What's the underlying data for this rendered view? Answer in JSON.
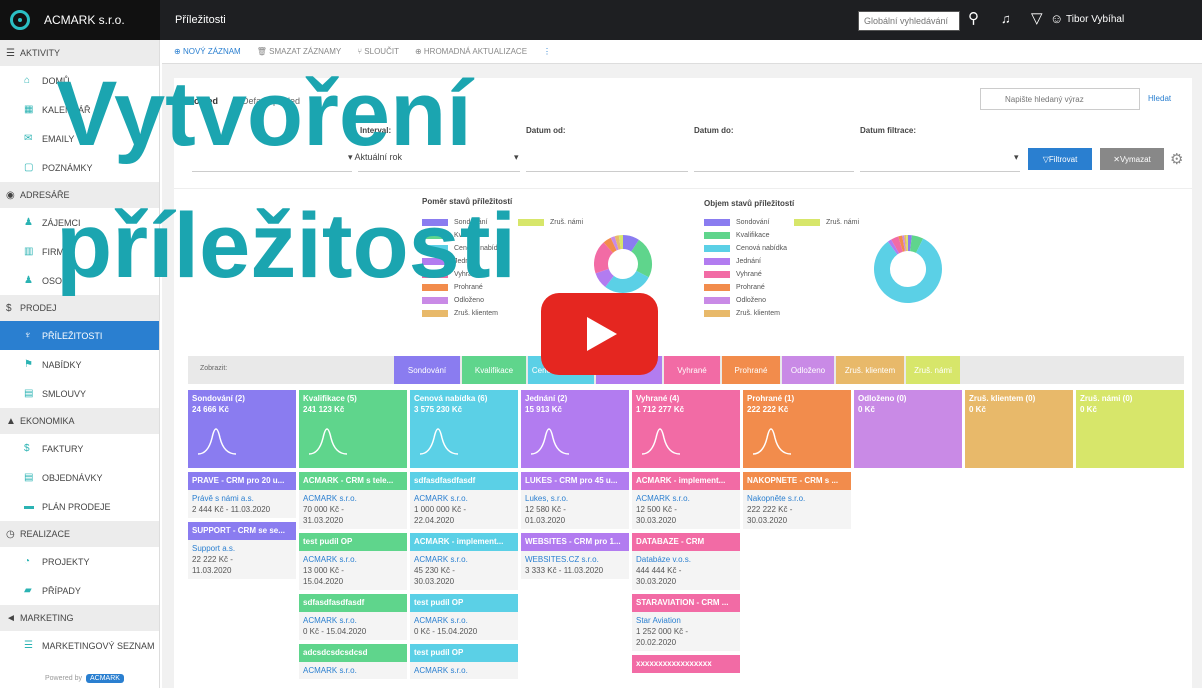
{
  "app": {
    "brand": "ACMARK s.r.o.",
    "page_title": "Příležitosti",
    "global_search_placeholder": "Globální vyhledávání",
    "user": "Tibor Vybíhal"
  },
  "sidebar": {
    "items": [
      {
        "type": "section",
        "label": "AKTIVITY",
        "icon": "list-icon"
      },
      {
        "type": "item",
        "label": "DOMŮ",
        "icon": "home-icon"
      },
      {
        "type": "item",
        "label": "KALENDÁŘ",
        "icon": "calendar-icon"
      },
      {
        "type": "item",
        "label": "EMAILY",
        "icon": "mail-icon"
      },
      {
        "type": "item",
        "label": "POZNÁMKY",
        "icon": "note-icon"
      },
      {
        "type": "section",
        "label": "ADRESÁŘE",
        "icon": "address-icon"
      },
      {
        "type": "item",
        "label": "ZÁJEMCI",
        "icon": "person-icon"
      },
      {
        "type": "item",
        "label": "FIRMY",
        "icon": "building-icon"
      },
      {
        "type": "item",
        "label": "OSOBY",
        "icon": "people-icon"
      },
      {
        "type": "section",
        "label": "PRODEJ",
        "icon": "dollar-icon"
      },
      {
        "type": "item",
        "label": "PŘÍLEŽITOSTI",
        "icon": "rocket-icon",
        "active": true
      },
      {
        "type": "item",
        "label": "NABÍDKY",
        "icon": "flag-icon"
      },
      {
        "type": "item",
        "label": "SMLOUVY",
        "icon": "doc-icon"
      },
      {
        "type": "section",
        "label": "EKONOMIKA",
        "icon": "chart-icon"
      },
      {
        "type": "item",
        "label": "FAKTURY",
        "icon": "dollar-icon"
      },
      {
        "type": "item",
        "label": "OBJEDNÁVKY",
        "icon": "order-icon"
      },
      {
        "type": "item",
        "label": "PLÁN PRODEJE",
        "icon": "plan-icon"
      },
      {
        "type": "section",
        "label": "REALIZACE",
        "icon": "realize-icon"
      },
      {
        "type": "item",
        "label": "PROJEKTY",
        "icon": "project-icon"
      },
      {
        "type": "item",
        "label": "PŘÍPADY",
        "icon": "folder-icon"
      },
      {
        "type": "section",
        "label": "MARKETING",
        "icon": "megaphone-icon"
      },
      {
        "type": "item",
        "label": "MARKETINGOVÝ SEZNAM",
        "icon": "list-icon"
      }
    ],
    "powered_by": "Powered by",
    "powered_brand": "ACMARK"
  },
  "toolbar": {
    "new": "NOVÝ ZÁZNAM",
    "delete": "SMAZAT ZÁZNAMY",
    "merge": "SLOUČIT",
    "mass_update": "HROMADNÁ AKTUALIZACE"
  },
  "tabs": {
    "view": "Pohled",
    "default": "Default pohled"
  },
  "search": {
    "placeholder": "Napište hledaný výraz",
    "link": "Hledat"
  },
  "filters": {
    "interval_label": "Interval:",
    "interval_value": "Aktuální rok",
    "date_from_label": "Datum od:",
    "date_to_label": "Datum do:",
    "filter_date_label": "Datum filtrace:",
    "filter_btn": "Filtrovat",
    "clear_btn": "Vymazat"
  },
  "charts": {
    "ratio_title": "Poměr stavů příležitostí",
    "volume_title": "Objem stavů příležitostí",
    "legend": [
      "Sondování",
      "Kvalifikace",
      "Cenová nabídka",
      "Jednání",
      "Vyhrané",
      "Prohrané",
      "Odloženo",
      "Zruš. klientem",
      "Zruš. námi"
    ],
    "colors": [
      "#8a7cf0",
      "#5fd58c",
      "#5bd0e6",
      "#b27cf0",
      "#f26ba5",
      "#f28c4c",
      "#c98ae6",
      "#e8b96a",
      "#d7e66a"
    ]
  },
  "show_label": "Zobrazit:",
  "chips": [
    "Sondování",
    "Kvalifikace",
    "Cenová nabídka",
    "Jednání",
    "Vyhrané",
    "Prohrané",
    "Odloženo",
    "Zruš. klientem",
    "Zruš. námi"
  ],
  "columns": [
    {
      "title": "Sondování (2)",
      "amount": "24 666 Kč",
      "color": "#8a7cf0",
      "cards": [
        {
          "title": "PRAVE - CRM pro 20 u...",
          "company": "Právě s námi a.s.",
          "info1": "2 444 Kč - 11.03.2020",
          "info2": ""
        },
        {
          "title": "SUPPORT - CRM se se...",
          "company": "Support a.s.",
          "info1": "22 222 Kč -",
          "info2": "11.03.2020"
        }
      ]
    },
    {
      "title": "Kvalifikace (5)",
      "amount": "241 123 Kč",
      "color": "#5fd58c",
      "cards": [
        {
          "title": "ACMARK - CRM s tele...",
          "company": "ACMARK s.r.o.",
          "info1": "70 000 Kč -",
          "info2": "31.03.2020"
        },
        {
          "title": "test pudíl OP",
          "company": "ACMARK s.r.o.",
          "info1": "13 000 Kč -",
          "info2": "15.04.2020"
        },
        {
          "title": "sdfasdfasdfasdf",
          "company": "ACMARK s.r.o.",
          "info1": "0 Kč - 15.04.2020",
          "info2": ""
        },
        {
          "title": "adcsdcsdcsdcsd",
          "company": "ACMARK s.r.o.",
          "info1": "",
          "info2": ""
        }
      ]
    },
    {
      "title": "Cenová nabídka (6)",
      "amount": "3 575 230 Kč",
      "color": "#5bd0e6",
      "cards": [
        {
          "title": "sdfasdfasdfasdf",
          "company": "ACMARK s.r.o.",
          "info1": "1 000 000 Kč -",
          "info2": "22.04.2020"
        },
        {
          "title": "ACMARK - implement...",
          "company": "ACMARK s.r.o.",
          "info1": "45 230 Kč -",
          "info2": "30.03.2020"
        },
        {
          "title": "test pudíl OP",
          "company": "ACMARK s.r.o.",
          "info1": "0 Kč - 15.04.2020",
          "info2": ""
        },
        {
          "title": "test pudíl OP",
          "company": "ACMARK s.r.o.",
          "info1": "",
          "info2": ""
        }
      ]
    },
    {
      "title": "Jednání (2)",
      "amount": "15 913 Kč",
      "color": "#b27cf0",
      "cards": [
        {
          "title": "LUKES - CRM pro 45 u...",
          "company": "Lukes, s.r.o.",
          "info1": "12 580 Kč -",
          "info2": "01.03.2020"
        },
        {
          "title": "WEBSITES - CRM pro 1...",
          "company": "WEBSITES.CZ s.r.o.",
          "info1": "3 333 Kč - 11.03.2020",
          "info2": ""
        }
      ]
    },
    {
      "title": "Vyhrané (4)",
      "amount": "1 712 277 Kč",
      "color": "#f26ba5",
      "cards": [
        {
          "title": "ACMARK - implement...",
          "company": "ACMARK s.r.o.",
          "info1": "12 500 Kč -",
          "info2": "30.03.2020"
        },
        {
          "title": "DATABAZE - CRM",
          "company": "Databáze v.o.s.",
          "info1": "444 444 Kč -",
          "info2": "30.03.2020"
        },
        {
          "title": "STARAVIATION - CRM ...",
          "company": "Star Aviation",
          "info1": "1 252 000 Kč -",
          "info2": "20.02.2020"
        },
        {
          "title": "xxxxxxxxxxxxxxxxx",
          "company": "",
          "info1": "",
          "info2": ""
        }
      ]
    },
    {
      "title": "Prohrané (1)",
      "amount": "222 222 Kč",
      "color": "#f28c4c",
      "cards": [
        {
          "title": "NAKOPNETE - CRM s ...",
          "company": "Nakopněte s.r.o.",
          "info1": "222 222 Kč -",
          "info2": "30.03.2020"
        }
      ]
    },
    {
      "title": "Odloženo (0)",
      "amount": "0 Kč",
      "color": "#c98ae6",
      "cards": []
    },
    {
      "title": "Zruš. klientem (0)",
      "amount": "0 Kč",
      "color": "#e8b96a",
      "cards": []
    },
    {
      "title": "Zruš. námi (0)",
      "amount": "0 Kč",
      "color": "#d7e66a",
      "cards": []
    }
  ],
  "overlay": {
    "line1": "Vytvoření",
    "line2": "příležitosti"
  }
}
